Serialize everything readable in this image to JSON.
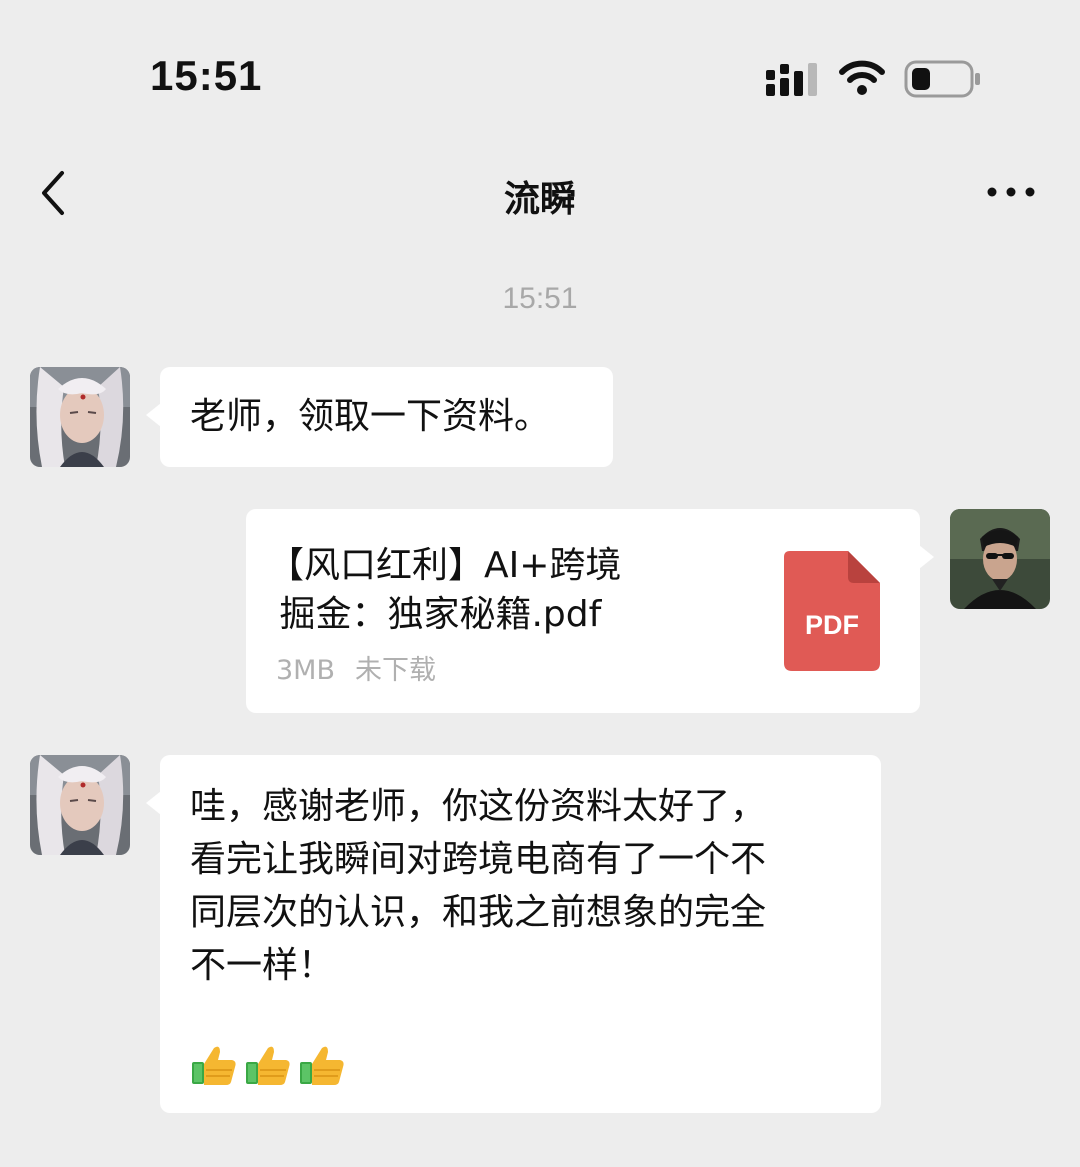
{
  "status_bar": {
    "time": "15:51"
  },
  "nav": {
    "title": "流瞬"
  },
  "chat": {
    "timestamp": "15:51",
    "messages": [
      {
        "sender": "other",
        "text": "老师，领取一下资料。"
      },
      {
        "sender": "self",
        "type": "file",
        "file_name": "【风口红利】AI+跨境\n 掘金：独家秘籍.pdf",
        "file_size": "3MB",
        "file_status": "未下载",
        "file_type_label": "PDF"
      },
      {
        "sender": "other",
        "text": "哇，感谢老师，你这份资料太好了，\n看完让我瞬间对跨境电商有了一个不\n同层次的认识，和我之前想象的完全\n不一样！",
        "emojis": [
          "thumbs-up-icon",
          "thumbs-up-icon",
          "thumbs-up-icon"
        ]
      }
    ]
  },
  "colors": {
    "background": "#ededed",
    "bubble": "#ffffff",
    "pdf_red": "#e05a55",
    "meta_gray": "#b0b0b0"
  }
}
